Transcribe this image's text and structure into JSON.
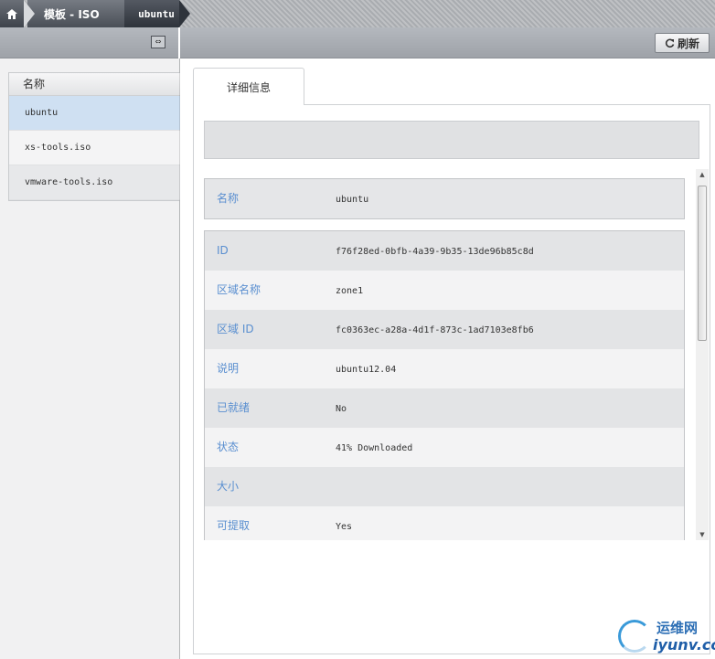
{
  "breadcrumb": {
    "home_icon": "home-icon",
    "section": "模板 - ISO",
    "current": "ubuntu"
  },
  "left_list": {
    "header": "名称",
    "items": [
      "ubuntu",
      "xs-tools.iso",
      "vmware-tools.iso"
    ],
    "selected": "ubuntu"
  },
  "toolbar": {
    "refresh_label": "刷新",
    "refresh_icon": "refresh-icon"
  },
  "tabs": {
    "detail": "详细信息"
  },
  "details": {
    "name_label": "名称",
    "name_value": "ubuntu",
    "rows": [
      {
        "label": "ID",
        "value": "f76f28ed-0bfb-4a39-9b35-13de96b85c8d"
      },
      {
        "label": "区域名称",
        "value": "zone1"
      },
      {
        "label": "区域 ID",
        "value": "fc0363ec-a28a-4d1f-873c-1ad7103e8fb6"
      },
      {
        "label": "说明",
        "value": "ubuntu12.04"
      },
      {
        "label": "已就绪",
        "value": "No"
      },
      {
        "label": "状态",
        "value": "41% Downloaded"
      },
      {
        "label": "大小",
        "value": ""
      },
      {
        "label": "可提取",
        "value": "Yes"
      }
    ]
  },
  "watermark": {
    "text_cn": "运维网",
    "text_en": "iyunv.com"
  },
  "colors": {
    "label_blue": "#5a8fd0",
    "selected_row": "#cfe0f2"
  }
}
